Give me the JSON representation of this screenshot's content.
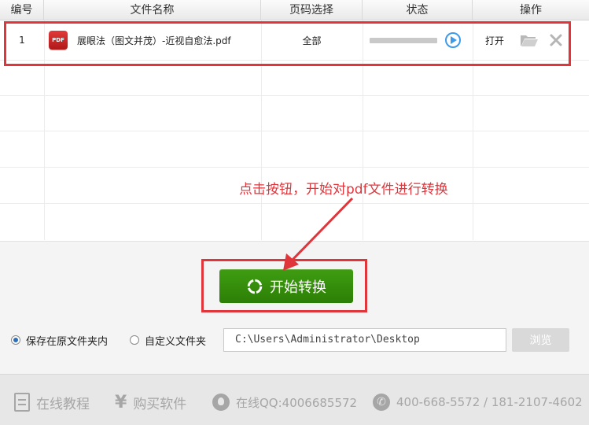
{
  "table": {
    "headers": {
      "index": "编号",
      "filename": "文件名称",
      "page_select": "页码选择",
      "status": "状态",
      "actions": "操作"
    },
    "rows": [
      {
        "index": "1",
        "file_icon_label": "PDF",
        "filename": "展眼法（图文并茂）-近视自愈法.pdf",
        "page_select": "全部",
        "progress": 0,
        "open_label": "打开"
      }
    ]
  },
  "annotation": {
    "text": "点击按钮，开始对pdf文件进行转换"
  },
  "convert": {
    "start_label": "开始转换",
    "save_original_label": "保存在原文件夹内",
    "custom_folder_label": "自定义文件夹",
    "selected_option": "save_original",
    "path_value": "C:\\Users\\Administrator\\Desktop",
    "browse_label": "浏览"
  },
  "footer": {
    "tutorial": "在线教程",
    "buy": "购买软件",
    "qq": "在线QQ:4006685572",
    "phone": "400-668-5572 / 181-2107-4602"
  },
  "colors": {
    "accent_red": "#e0353b",
    "button_green": "#339012",
    "progress_blue": "#3d9be9"
  }
}
